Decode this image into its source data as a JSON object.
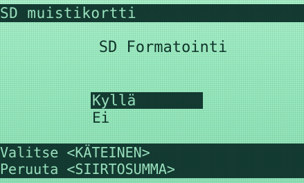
{
  "header": {
    "title": "SD muistikortti"
  },
  "dialog": {
    "heading": "SD Formatointi",
    "options": [
      {
        "label": "Kyllä",
        "selected": true
      },
      {
        "label": "Ei",
        "selected": false
      }
    ]
  },
  "footer": {
    "select_hint": "Valitse <KÄTEINEN>",
    "cancel_hint": "Peruuta <SIIRTOSUMMA>"
  },
  "colors": {
    "lcd_background": "#99ebc0",
    "lcd_dark": "#143c33",
    "lcd_text_on_dark": "#9ee8c3"
  }
}
